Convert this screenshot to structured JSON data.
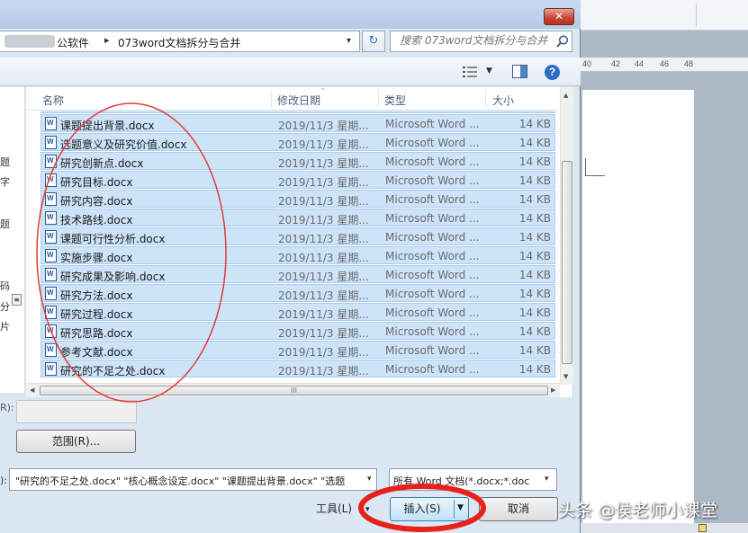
{
  "dialog": {
    "close_glyph": "✕",
    "address": {
      "breadcrumb": [
        "公软件",
        "073word文档拆分与合并"
      ],
      "separator": "▸",
      "dropdown_glyph": "▾"
    },
    "refresh_glyph": "↻",
    "search": {
      "placeholder": "搜索 073word文档拆分与合并"
    },
    "help_glyph": "?",
    "view_dropdown_glyph": "▼",
    "nav_pane": {
      "fragments": [
        "题",
        "字",
        "题",
        "码",
        "分",
        "片"
      ],
      "scroll_glyph": "≡"
    },
    "columns": {
      "name": "名称",
      "date": "修改日期",
      "type": "类型",
      "size": "大小"
    },
    "sort_glyph": "⌃",
    "files": [
      {
        "name": "课题提出背景.docx",
        "date": "2019/11/3 星期...",
        "type": "Microsoft Word ...",
        "size": "14 KB"
      },
      {
        "name": "选题意义及研究价值.docx",
        "date": "2019/11/3 星期...",
        "type": "Microsoft Word ...",
        "size": "14 KB"
      },
      {
        "name": "研究创新点.docx",
        "date": "2019/11/3 星期...",
        "type": "Microsoft Word ...",
        "size": "14 KB"
      },
      {
        "name": "研究目标.docx",
        "date": "2019/11/3 星期...",
        "type": "Microsoft Word ...",
        "size": "14 KB"
      },
      {
        "name": "研究内容.docx",
        "date": "2019/11/3 星期...",
        "type": "Microsoft Word ...",
        "size": "14 KB"
      },
      {
        "name": "技术路线.docx",
        "date": "2019/11/3 星期...",
        "type": "Microsoft Word ...",
        "size": "14 KB"
      },
      {
        "name": "课题可行性分析.docx",
        "date": "2019/11/3 星期...",
        "type": "Microsoft Word ...",
        "size": "14 KB"
      },
      {
        "name": "实施步骤.docx",
        "date": "2019/11/3 星期...",
        "type": "Microsoft Word ...",
        "size": "14 KB"
      },
      {
        "name": "研究成果及影响.docx",
        "date": "2019/11/3 星期...",
        "type": "Microsoft Word ...",
        "size": "14 KB"
      },
      {
        "name": "研究方法.docx",
        "date": "2019/11/3 星期...",
        "type": "Microsoft Word ...",
        "size": "14 KB"
      },
      {
        "name": "研究过程.docx",
        "date": "2019/11/3 星期...",
        "type": "Microsoft Word ...",
        "size": "14 KB"
      },
      {
        "name": "研究思路.docx",
        "date": "2019/11/3 星期...",
        "type": "Microsoft Word ...",
        "size": "14 KB"
      },
      {
        "name": "参考文献.docx",
        "date": "2019/11/3 星期...",
        "type": "Microsoft Word ...",
        "size": "14 KB"
      },
      {
        "name": "研究的不足之处.docx",
        "date": "2019/11/3 星期...",
        "type": "Microsoft Word ...",
        "size": "14 KB"
      }
    ],
    "scroll_glyphs": {
      "up": "▲",
      "down": "▼",
      "left": "◀",
      "right": "▶",
      "grip": "III"
    },
    "range": {
      "label": "R):",
      "button": "范围(R)..."
    },
    "filename": {
      "label": "):",
      "value": "\"研究的不足之处.docx\" \"核心概念设定.docx\" \"课题提出背景.docx\" \"选题",
      "dropdown_glyph": "▾"
    },
    "filetype": {
      "value": "所有 Word 文档(*.docx;*.doc",
      "dropdown_glyph": "▾"
    },
    "tools": {
      "label": "工具(L)",
      "arrow": "▾"
    },
    "insert": {
      "label": "插入(S)",
      "arrow": "▼"
    },
    "cancel": {
      "label": "取消"
    }
  },
  "word_background": {
    "ruler_ticks": [
      "40",
      "42",
      "44",
      "46",
      "48"
    ]
  },
  "watermark": "头条 @侯老师小课堂",
  "colors": {
    "selection": "#cce3f8",
    "selection_border": "#a9cdee",
    "annotation": "#e53935",
    "annotation_bold": "#e8211d"
  }
}
